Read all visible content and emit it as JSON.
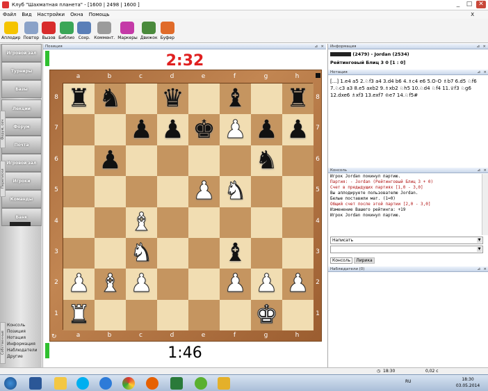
{
  "window": {
    "title": "Клуб \"Шахматная планета\" - [1600 | 2498 | 1600 ]",
    "controls": [
      "_",
      "□",
      "✕"
    ],
    "close_secondary": "X"
  },
  "menu": [
    "Файл",
    "Вид",
    "Настройки",
    "Окна",
    "Помощь"
  ],
  "toolbar": [
    {
      "label": "Аплодир",
      "icon": "smiley-icon",
      "color": "#f5c400"
    },
    {
      "label": "Повтор",
      "icon": "robot-icon",
      "color": "#8aa2c8"
    },
    {
      "label": "Вызов",
      "icon": "dice-icon",
      "color": "#d82c2c"
    },
    {
      "label": "Библио",
      "icon": "books-icon",
      "color": "#3aa657"
    },
    {
      "label": "Сохр.",
      "icon": "save-icon",
      "color": "#5a7fb8"
    },
    {
      "label": "Коммент.",
      "icon": "pencil-icon",
      "color": "#9b9b9b"
    },
    {
      "label": "Маркеры",
      "icon": "markers-icon",
      "color": "#c43aa7"
    },
    {
      "label": "Движок",
      "icon": "engine-icon",
      "color": "#4a8a3c"
    },
    {
      "label": "Буфер",
      "icon": "puzzle-icon",
      "color": "#e06b2a"
    }
  ],
  "left_nav": [
    "Игровой зал",
    "Турниры",
    "Базы",
    "Лекции",
    "Форум",
    "Почта",
    "Игровой зал",
    "Игроки",
    "Команды",
    "Банк"
  ],
  "left_vtabs": [
    "Форум, сеч",
    "Переписки"
  ],
  "left_links": [
    "Консоль",
    "Позиция",
    "Нотация",
    "Информация",
    "Наблюдатели",
    "Другие"
  ],
  "left_bottom_vtab": "Собственные",
  "board": {
    "pane_title": "Позиция",
    "timer_top": "2:32",
    "timer_bottom": "1:46",
    "files": [
      "a",
      "b",
      "c",
      "d",
      "e",
      "f",
      "g",
      "h"
    ],
    "ranks": [
      "8",
      "7",
      "6",
      "5",
      "4",
      "3",
      "2",
      "1"
    ],
    "position": [
      "r b q b r",
      "  p p k p p p",
      " p      n ",
      "    P N  ",
      "  B      ",
      "  N  b   ",
      "P B P  P P P",
      "R    K   "
    ],
    "pieces": [
      [
        "bR",
        "bN",
        "",
        "bQ",
        "",
        "bB",
        "",
        "bR"
      ],
      [
        "",
        "",
        "bP",
        "bP",
        "bK",
        "wP",
        "bP",
        "bP"
      ],
      [
        "",
        "bP",
        "",
        "",
        "",
        "",
        "bN",
        ""
      ],
      [
        "",
        "",
        "",
        "",
        "wP",
        "wN",
        "",
        ""
      ],
      [
        "",
        "",
        "wB",
        "",
        "",
        "",
        "",
        ""
      ],
      [
        "",
        "",
        "wN",
        "",
        "",
        "bB",
        "",
        ""
      ],
      [
        "wP",
        "wB",
        "wP",
        "",
        "",
        "wP",
        "wP",
        "wP"
      ],
      [
        "wR",
        "",
        "",
        "",
        "",
        "",
        "wK",
        ""
      ]
    ]
  },
  "info": {
    "pane_title": "Информация",
    "players_line": "(2479) - Jordan (2534)",
    "game_type": "Рейтинговый Блиц 3 0 [1 : 0]"
  },
  "notation": {
    "pane_title": "Нотация",
    "text": "[...] 1.e4 a5 2.♘f3 a4 3.d4 b6 4.♗c4 e6 5.O-O ♗b7 6.d5 ♘f6 7.♘c3 a3 8.e5 axb2 9.♗xb2 ♘h5 10.♘d4 ♘f4 11.♕f3 ♘g6 12.dxe6 ♗xf3 13.exf7 ♔e7 14.♘f5#"
  },
  "console": {
    "pane_title": "Консоль",
    "lines": [
      {
        "text": "Игрок Jordan покинул партию.",
        "color": "#000"
      },
      {
        "text": "Партия:          - Jordan (Рейтинговый Блиц 3 + 0)",
        "color": "#b01010"
      },
      {
        "text": "Счет в предыдущих партиях [1,0 - 3,0]",
        "color": "#b01010"
      },
      {
        "text": "Вы аплодируете пользователю Jordan.",
        "color": "#000"
      },
      {
        "text": "Белые поставили мат. (1=0)",
        "color": "#000"
      },
      {
        "text": "Общий счет после этой партии [2,0 - 3,0]",
        "color": "#b01010"
      },
      {
        "text": "Изменение Вашего рейтинга: +19",
        "color": "#000"
      },
      {
        "text": "Игрок Jordan покинул партию.",
        "color": "#000"
      }
    ],
    "combo_value": "Написать",
    "tabs": [
      "Консоль",
      "Лирика"
    ]
  },
  "observers": {
    "pane_title": "Наблюдатели (0)"
  },
  "status": {
    "time": "18:30",
    "value": "0,02 c"
  },
  "taskbar": {
    "clock_time": "18:30",
    "clock_date": "03.05.2014",
    "lang": "RU"
  }
}
